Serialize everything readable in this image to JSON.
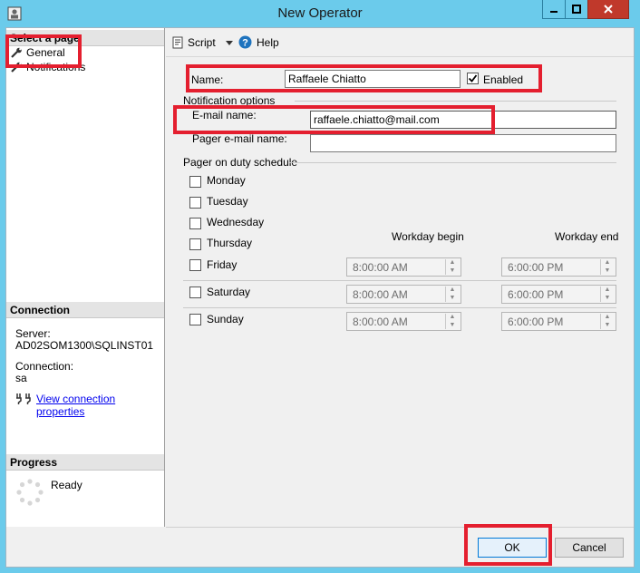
{
  "window": {
    "title": "New Operator"
  },
  "left_pane": {
    "select_page_header": "Select a page",
    "pages": [
      {
        "label": "General",
        "icon": "wrench-icon"
      },
      {
        "label": "Notifications",
        "icon": "wrench-icon"
      }
    ],
    "connection": {
      "header": "Connection",
      "server_label": "Server:",
      "server_value": "AD02SOM1300\\SQLINST01",
      "connection_label": "Connection:",
      "connection_value": "sa",
      "view_link": "View connection properties"
    },
    "progress": {
      "header": "Progress",
      "status": "Ready"
    }
  },
  "toolbar": {
    "script_label": "Script",
    "help_label": "Help"
  },
  "general": {
    "name_label": "Name:",
    "name_value": "Raffaele Chiatto",
    "enabled_label": "Enabled",
    "enabled_checked": true,
    "notification_options_label": "Notification options",
    "email_label": "E-mail name:",
    "email_value": "raffaele.chiatto@mail.com",
    "pager_label": "Pager e-mail name:",
    "pager_value": "",
    "pager_schedule_label": "Pager on duty schedule",
    "days": [
      {
        "label": "Monday",
        "checked": false
      },
      {
        "label": "Tuesday",
        "checked": false
      },
      {
        "label": "Wednesday",
        "checked": false
      },
      {
        "label": "Thursday",
        "checked": false
      },
      {
        "label": "Friday",
        "checked": false
      },
      {
        "label": "Saturday",
        "checked": false
      },
      {
        "label": "Sunday",
        "checked": false
      }
    ],
    "workday_begin_label": "Workday begin",
    "workday_end_label": "Workday end",
    "schedules": [
      {
        "day": "Friday",
        "begin": "8:00:00 AM",
        "end": "6:00:00 PM"
      },
      {
        "day": "Saturday",
        "begin": "8:00:00 AM",
        "end": "6:00:00 PM"
      },
      {
        "day": "Sunday",
        "begin": "8:00:00 AM",
        "end": "6:00:00 PM"
      }
    ]
  },
  "buttons": {
    "ok": "OK",
    "cancel": "Cancel"
  },
  "colors": {
    "titlebar": "#6bcbeb",
    "highlight": "#e41f2f",
    "link": "#0000ee"
  }
}
